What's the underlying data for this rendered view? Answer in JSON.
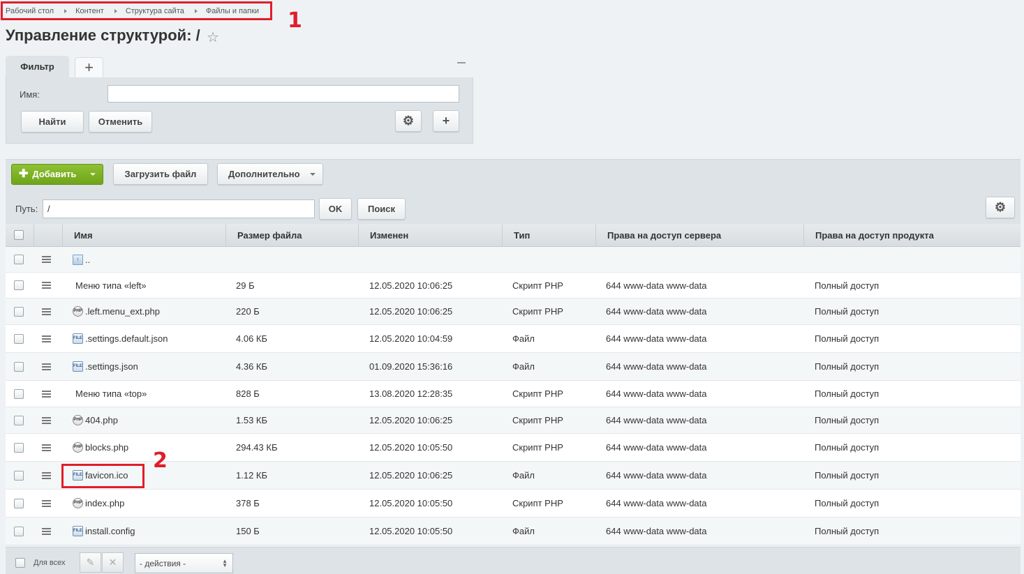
{
  "breadcrumb": [
    "Рабочий стол",
    "Контент",
    "Структура сайта",
    "Файлы и папки"
  ],
  "annotations": [
    "1",
    "2"
  ],
  "page": {
    "title": "Управление структурой: /",
    "star_icon": "star-icon"
  },
  "filter": {
    "tab_label": "Фильтр",
    "add_tab": "+",
    "name_label": "Имя:",
    "name_value": "",
    "find_label": "Найти",
    "cancel_label": "Отменить",
    "settings_icon": "⚙",
    "add_icon": "+"
  },
  "toolbar": {
    "add_label": "Добавить",
    "upload_label": "Загрузить файл",
    "more_label": "Дополнительно",
    "path_label": "Путь:",
    "path_value": "/",
    "ok_label": "OK",
    "search_label": "Поиск",
    "settings_icon": "⚙"
  },
  "table": {
    "headers": [
      "Имя",
      "Размер файла",
      "Изменен",
      "Тип",
      "Права на доступ сервера",
      "Права на доступ продукта"
    ],
    "rows": [
      {
        "icon": "up",
        "name": "..",
        "size": "",
        "modified": "",
        "type": "",
        "server": "",
        "product": ""
      },
      {
        "icon": "none",
        "name": "Меню типа «left»",
        "size": "29 Б",
        "modified": "12.05.2020 10:06:25",
        "type": "Скрипт PHP",
        "server": "644 www-data www-data",
        "product": "Полный доступ"
      },
      {
        "icon": "php",
        "name": ".left.menu_ext.php",
        "size": "220 Б",
        "modified": "12.05.2020 10:06:25",
        "type": "Скрипт PHP",
        "server": "644 www-data www-data",
        "product": "Полный доступ"
      },
      {
        "icon": "file",
        "name": ".settings.default.json",
        "size": "4.06 КБ",
        "modified": "12.05.2020 10:04:59",
        "type": "Файл",
        "server": "644 www-data www-data",
        "product": "Полный доступ"
      },
      {
        "icon": "file",
        "name": ".settings.json",
        "size": "4.36 КБ",
        "modified": "01.09.2020 15:36:16",
        "type": "Файл",
        "server": "644 www-data www-data",
        "product": "Полный доступ"
      },
      {
        "icon": "none",
        "name": "Меню типа «top»",
        "size": "828 Б",
        "modified": "13.08.2020 12:28:35",
        "type": "Скрипт PHP",
        "server": "644 www-data www-data",
        "product": "Полный доступ"
      },
      {
        "icon": "php",
        "name": "404.php",
        "size": "1.53 КБ",
        "modified": "12.05.2020 10:06:25",
        "type": "Скрипт PHP",
        "server": "644 www-data www-data",
        "product": "Полный доступ"
      },
      {
        "icon": "php",
        "name": "blocks.php",
        "size": "294.43 КБ",
        "modified": "12.05.2020 10:05:50",
        "type": "Скрипт PHP",
        "server": "644 www-data www-data",
        "product": "Полный доступ"
      },
      {
        "icon": "file",
        "name": "favicon.ico",
        "size": "1.12 КБ",
        "modified": "12.05.2020 10:06:25",
        "type": "Файл",
        "server": "644 www-data www-data",
        "product": "Полный доступ"
      },
      {
        "icon": "php",
        "name": "index.php",
        "size": "378 Б",
        "modified": "12.05.2020 10:05:50",
        "type": "Скрипт PHP",
        "server": "644 www-data www-data",
        "product": "Полный доступ"
      },
      {
        "icon": "file",
        "name": "install.config",
        "size": "150 Б",
        "modified": "12.05.2020 10:05:50",
        "type": "Файл",
        "server": "644 www-data www-data",
        "product": "Полный доступ"
      }
    ]
  },
  "footer": {
    "for_all_label": "Для всех",
    "edit_icon": "✎",
    "delete_icon": "✕",
    "actions_value": "- действия -"
  },
  "colors": {
    "annotation": "#e11d2a",
    "add_button": "#7ab024"
  }
}
